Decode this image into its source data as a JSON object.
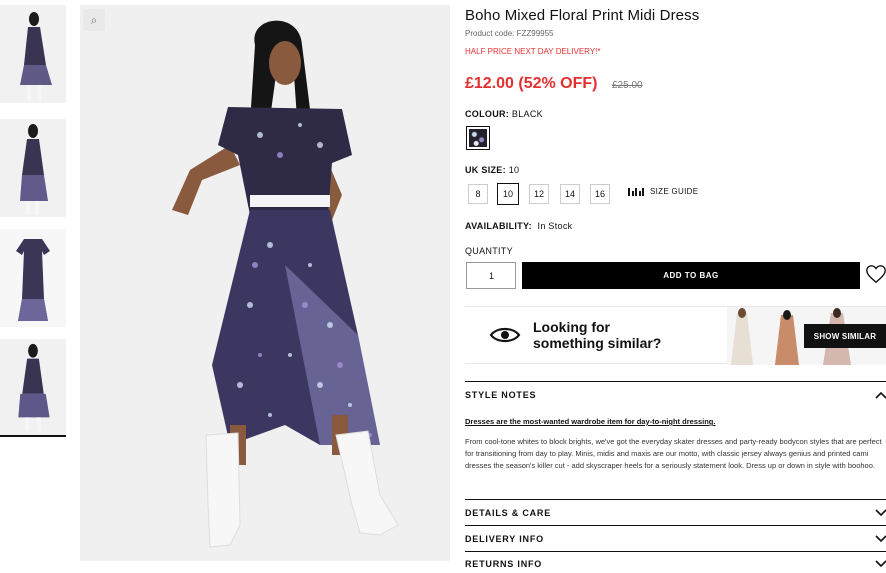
{
  "product": {
    "title": "Boho Mixed Floral Print Midi Dress",
    "code": "Product code: FZZ99955",
    "promo": "HALF PRICE NEXT DAY DELIVERY!*",
    "price": "£12.00 (52% OFF)",
    "was_price": "£25.00"
  },
  "colour": {
    "label": "COLOUR:",
    "value": "BLACK"
  },
  "size": {
    "label": "UK SIZE:",
    "value": "10",
    "options": [
      "8",
      "10",
      "12",
      "14",
      "16"
    ],
    "guide": "SIZE GUIDE"
  },
  "availability": {
    "label": "AVAILABILITY:",
    "value": "In Stock"
  },
  "quantity": {
    "label": "QUANTITY",
    "value": "1"
  },
  "add_to_bag": "ADD TO BAG",
  "similar": {
    "line1": "Looking for",
    "line2": "something similar?",
    "button": "SHOW SIMILAR"
  },
  "style_notes": {
    "title": "STYLE NOTES",
    "link": "Dresses are the most-wanted wardrobe item for day-to-night dressing.",
    "body": "From cool-tone whites to block brights, we've got the everyday skater dresses and party-ready bodycon styles that are perfect for transitioning from day to play. Minis, midis and maxis are our motto, with classic jersey always genius and printed cami dresses the season's killer cut - add skyscraper heels for a seriously statement look. Dress up or down in style with boohoo."
  },
  "accordions": [
    "DETAILS & CARE",
    "DELIVERY INFO",
    "RETURNS INFO"
  ],
  "colors": {
    "sale": "#e2302f",
    "button": "#000000"
  }
}
